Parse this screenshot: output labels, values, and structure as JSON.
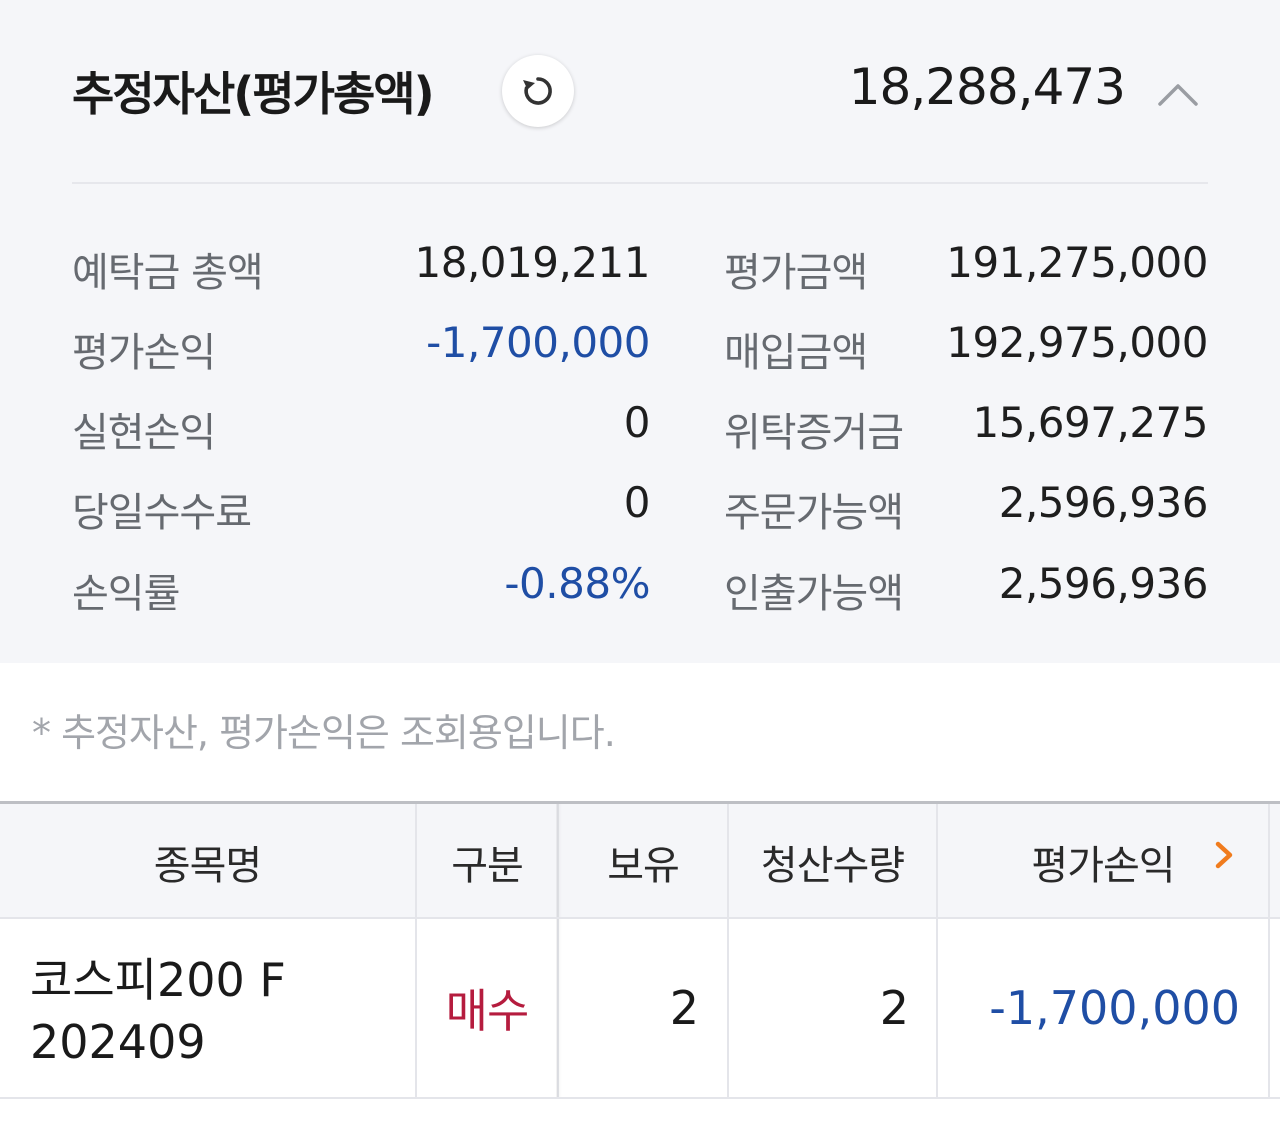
{
  "summary": {
    "title": "추정자산(평가총액)",
    "total": "18,288,473",
    "rows_left": [
      {
        "label": "예탁금 총액",
        "value": "18,019,211"
      },
      {
        "label": "평가손익",
        "value": "-1,700,000"
      },
      {
        "label": "실현손익",
        "value": "0"
      },
      {
        "label": "당일수수료",
        "value": "0"
      },
      {
        "label": "손익률",
        "value": "-0.88%"
      }
    ],
    "rows_right": [
      {
        "label": "평가금액",
        "value": "191,275,000"
      },
      {
        "label": "매입금액",
        "value": "192,975,000"
      },
      {
        "label": "위탁증거금",
        "value": "15,697,275"
      },
      {
        "label": "주문가능액",
        "value": "2,596,936"
      },
      {
        "label": "인출가능액",
        "value": "2,596,936"
      }
    ],
    "icons": {
      "refresh": "refresh-icon",
      "collapse": "chevron-up-icon"
    }
  },
  "note": "* 추정자산, 평가손익은 조회용입니다.",
  "table": {
    "headers": [
      "종목명",
      "구분",
      "보유",
      "청산수량",
      "평가손익"
    ],
    "rows": [
      {
        "name_line1": "코스피200 F",
        "name_line2": "202409",
        "type": "매수",
        "holding": "2",
        "close_qty": "2",
        "pnl": "-1,700,000"
      }
    ]
  },
  "colors": {
    "negative": "#1f4ea5",
    "buy": "#b51c3e",
    "accent_arrow": "#f07c1e",
    "panel_bg": "#f5f6f9"
  }
}
